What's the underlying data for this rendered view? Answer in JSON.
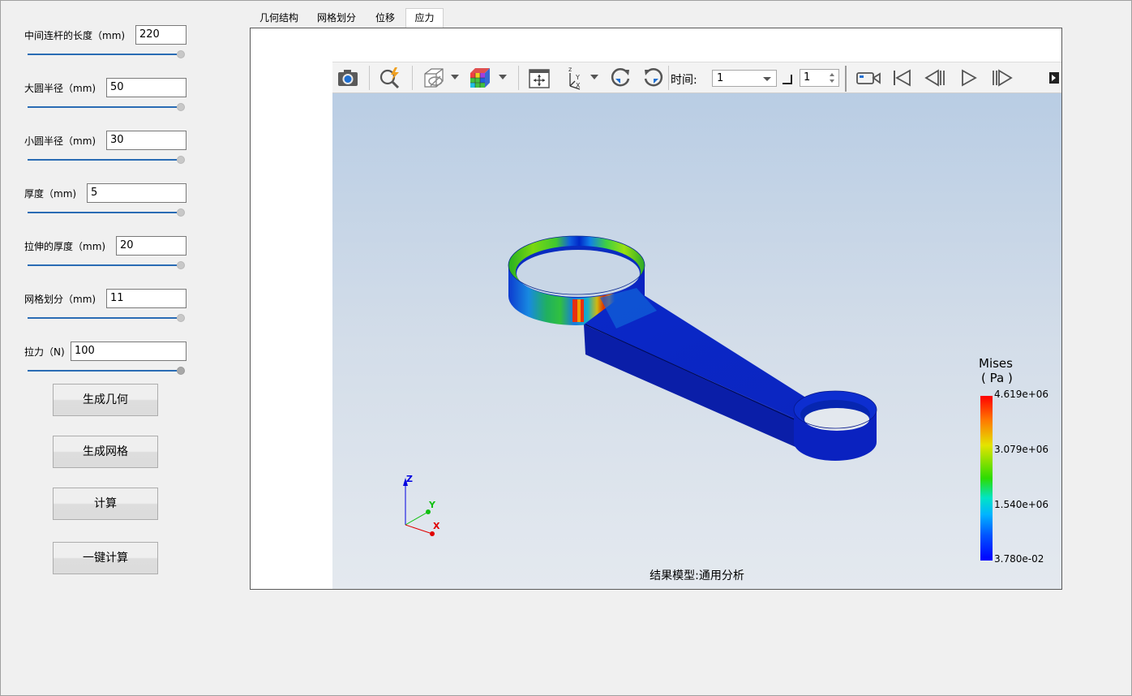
{
  "params": [
    {
      "label": "中间连杆的长度（mm)",
      "value": "220",
      "fill": 1.0
    },
    {
      "label": "大圆半径（mm)",
      "value": "50",
      "fill": 1.0
    },
    {
      "label": "小圆半径（mm)",
      "value": "30",
      "fill": 1.0
    },
    {
      "label": "厚度（mm)",
      "value": "5",
      "fill": 1.0
    },
    {
      "label": "拉伸的厚度（mm)",
      "value": "20",
      "fill": 1.0
    },
    {
      "label": "网格划分（mm)",
      "value": "11",
      "fill": 1.0
    },
    {
      "label": "拉力（N)",
      "value": "100",
      "fill": 1.0
    }
  ],
  "buttons": {
    "generate_geometry": "生成几何",
    "generate_mesh": "生成网格",
    "compute": "计算",
    "one_click_compute": "一键计算"
  },
  "tabs": [
    "几何结构",
    "网格划分",
    "位移",
    "应力"
  ],
  "active_tab": "应力",
  "toolbar": {
    "time_label": "时间:",
    "time_value": "1",
    "step_value": "1"
  },
  "viewer": {
    "caption": "结果模型:通用分析",
    "legend": {
      "title_line1": "Mises",
      "title_line2": "( Pa )",
      "values": [
        "4.619e+06",
        "3.079e+06",
        "1.540e+06",
        "3.780e-02"
      ]
    },
    "axes": {
      "x": "X",
      "y": "Y",
      "z": "Z"
    }
  },
  "colors": {
    "slider_fill": "#2a6cb4",
    "part_blue": "#0a22c8"
  }
}
